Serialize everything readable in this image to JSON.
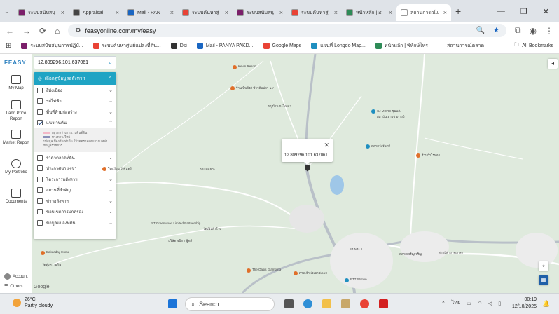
{
  "browser": {
    "tabs": [
      {
        "label": "ระบบสนับสนุ",
        "favicon_color": "#7b1f6a",
        "active": false
      },
      {
        "label": "Appraisal",
        "favicon_color": "#444444",
        "active": false
      },
      {
        "label": "Mail - PAN",
        "favicon_color": "#1a66c2",
        "active": false
      },
      {
        "label": "ระบบค้นหาสู่",
        "favicon_color": "#e94235",
        "active": false
      },
      {
        "label": "ระบบสนับสนุ",
        "favicon_color": "#7b1f6a",
        "active": false
      },
      {
        "label": "ระบบค้นหาสู่",
        "favicon_color": "#e94235",
        "active": false
      },
      {
        "label": "หน้าหลัก | Ƨ",
        "favicon_color": "#2e8b57",
        "active": false
      },
      {
        "label": "สถานการณ์แ",
        "favicon_color": "#ffffff",
        "active": true
      }
    ],
    "new_tab": "+",
    "url": "feasyonline.com/myfeasy",
    "bookmarks": [
      {
        "label": "ระบบสนับสนุนการปฏิบั...",
        "color": "#7b1f6a"
      },
      {
        "label": "ระบบค้นหาศูนย์แปลงที่ดิน...",
        "color": "#e94235"
      },
      {
        "label": "Dsi",
        "color": "#333333"
      },
      {
        "label": "Mail - PANYA PAKD...",
        "color": "#1a66c2"
      },
      {
        "label": "Google Maps",
        "color": "#e94235"
      },
      {
        "label": "แผนที่ Longdo Map...",
        "color": "#1f8fc0"
      },
      {
        "label": "หน้าหลัก | พิทักษ์ไทร",
        "color": "#2e8b57"
      },
      {
        "label": "สถานการณ์ตลาด",
        "color": "#ffffff"
      }
    ],
    "all_bookmarks": "All Bookmarks"
  },
  "sidebar": {
    "logo": "FEASY",
    "items": [
      {
        "label": "My Map"
      },
      {
        "label": "Land Price Report"
      },
      {
        "label": "Market Report"
      },
      {
        "label": "My Portfolio"
      },
      {
        "label": "Documents"
      }
    ],
    "account": "Account",
    "others": "Others"
  },
  "search": {
    "value": "12.809296,101.637061"
  },
  "layers_panel": {
    "header": "เลือกดูข้อมูลอสังหาฯ",
    "items": [
      {
        "label": "สีผังเมือง",
        "checked": false,
        "expanded": false
      },
      {
        "label": "รถไฟฟ้า",
        "checked": false,
        "expanded": false
      },
      {
        "label": "พื้นที่ห้ามก่อสร้าง",
        "checked": false,
        "expanded": false
      },
      {
        "label": "แนวเวนคืน",
        "checked": true,
        "expanded": true
      },
      {
        "label": "ราคาตลาดที่ดิน",
        "checked": false,
        "expanded": false
      },
      {
        "label": "ประกาศขาย-เช่า",
        "checked": false,
        "expanded": false
      },
      {
        "label": "โครงการอสังหาฯ",
        "checked": false,
        "expanded": false
      },
      {
        "label": "สถานที่สำคัญ",
        "checked": false,
        "expanded": false
      },
      {
        "label": "ข่าวอสังหาฯ",
        "checked": false,
        "expanded": false
      },
      {
        "label": "ขอบเขตการปกครอง",
        "checked": false,
        "expanded": false
      },
      {
        "label": "ข้อมูลแปลงที่ดิน",
        "checked": false,
        "expanded": false
      }
    ],
    "legend": [
      {
        "label": "อยู่ระหว่างการเวนคืนที่ดิน",
        "color": "#f3b8c8"
      },
      {
        "label": "ทางหลวงใหม่",
        "color": "#8a8fb8"
      }
    ],
    "legend_note": "*ข้อมูลเบื้องต้นเท่านั้น โปรดตรวจสอบจากแหล่งข้อมูลราชการ"
  },
  "map": {
    "popup_coords": "12.809296,101.637061",
    "labels": [
      {
        "text": "Kevin Resort"
      },
      {
        "text": "ร้าน ทิพย์รส ข้าวต้มปลา ๑๙"
      },
      {
        "text": "หมู่บ้าน กะไฉน 3"
      },
      {
        "text": "CJ MORE ชุมแสง"
      },
      {
        "text": "สถาบันเยาวชนการวิ"
      },
      {
        "text": "ตลาดวังจันทร์"
      },
      {
        "text": "ร้านกำไรทอง"
      },
      {
        "text": "สถานีตำรวจแกลง"
      },
      {
        "text": "โรงเรียน วังจันทร์"
      },
      {
        "text": "ST Greenwood Limited Partnership"
      },
      {
        "text": "วัดเนินสำโรง"
      },
      {
        "text": "วัดเนินเผาะ"
      },
      {
        "text": "บริษัท ชนิกา ฟู้ดส์"
      },
      {
        "text": "Bakeaday Home"
      },
      {
        "text": "The Oasis Glamping"
      },
      {
        "text": "ศาลเจ้าพ่อเขาชะเมา"
      },
      {
        "text": "PTT Station"
      },
      {
        "text": "ตลาดเจริญเจริญ"
      },
      {
        "text": "แม่พระ 1"
      },
      {
        "text": "วัดทุ่งควายกิน"
      }
    ],
    "google": "Google"
  },
  "taskbar": {
    "temperature": "26°C",
    "weather": "Partly cloudy",
    "search_placeholder": "Search",
    "language": "ไทย",
    "time": "00:19",
    "date": "12/10/2025"
  }
}
